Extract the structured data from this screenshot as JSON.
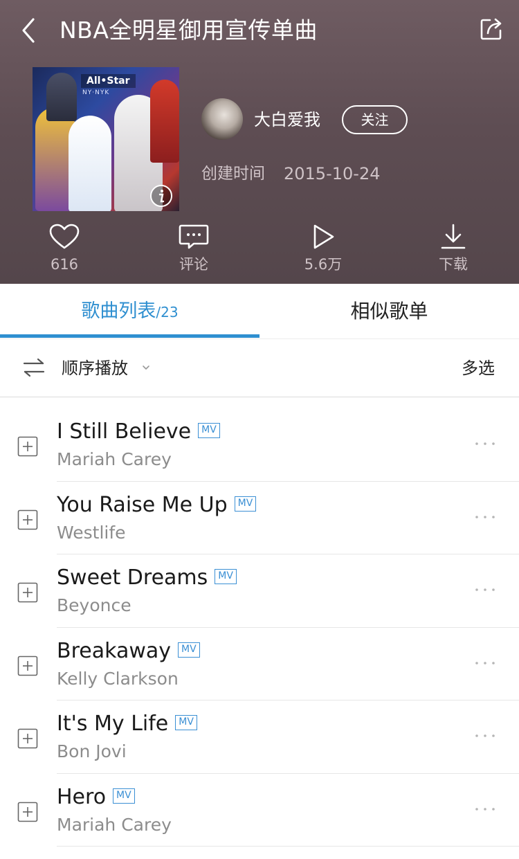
{
  "header": {
    "title": "NBA全明星御用宣传单曲",
    "back_icon": "chevron-left-icon",
    "share_icon": "share-icon",
    "cover": {
      "badge": "All•Star",
      "subtext": "NY·NYK",
      "info_icon": "info-icon"
    },
    "creator": {
      "name": "大白爱我",
      "follow_label": "关注"
    },
    "created_label": "创建时间",
    "created_date": "2015-10-24",
    "actions": [
      {
        "icon": "heart-icon",
        "label": "616"
      },
      {
        "icon": "comment-icon",
        "label": "评论"
      },
      {
        "icon": "play-icon",
        "label": "5.6万"
      },
      {
        "icon": "download-icon",
        "label": "下载"
      }
    ]
  },
  "tabs": {
    "songs_label": "歌曲列表",
    "songs_count": "/23",
    "similar_label": "相似歌单",
    "active_color": "#2f8fd0"
  },
  "modebar": {
    "mode_label": "顺序播放",
    "multi_select_label": "多选"
  },
  "songs": [
    {
      "title": "I Still Believe",
      "artist": "Mariah Carey",
      "badge": "MV"
    },
    {
      "title": "You Raise Me Up",
      "artist": "Westlife",
      "badge": "MV"
    },
    {
      "title": "Sweet Dreams",
      "artist": "Beyonce",
      "badge": "MV"
    },
    {
      "title": "Breakaway",
      "artist": "Kelly Clarkson",
      "badge": "MV"
    },
    {
      "title": "It's My Life",
      "artist": "Bon Jovi",
      "badge": "MV"
    },
    {
      "title": "Hero",
      "artist": "Mariah Carey",
      "badge": "MV"
    }
  ],
  "colors": {
    "header_bg": "#5e4d53",
    "accent": "#2f8fd0",
    "muted_text": "#8c8c8c"
  }
}
